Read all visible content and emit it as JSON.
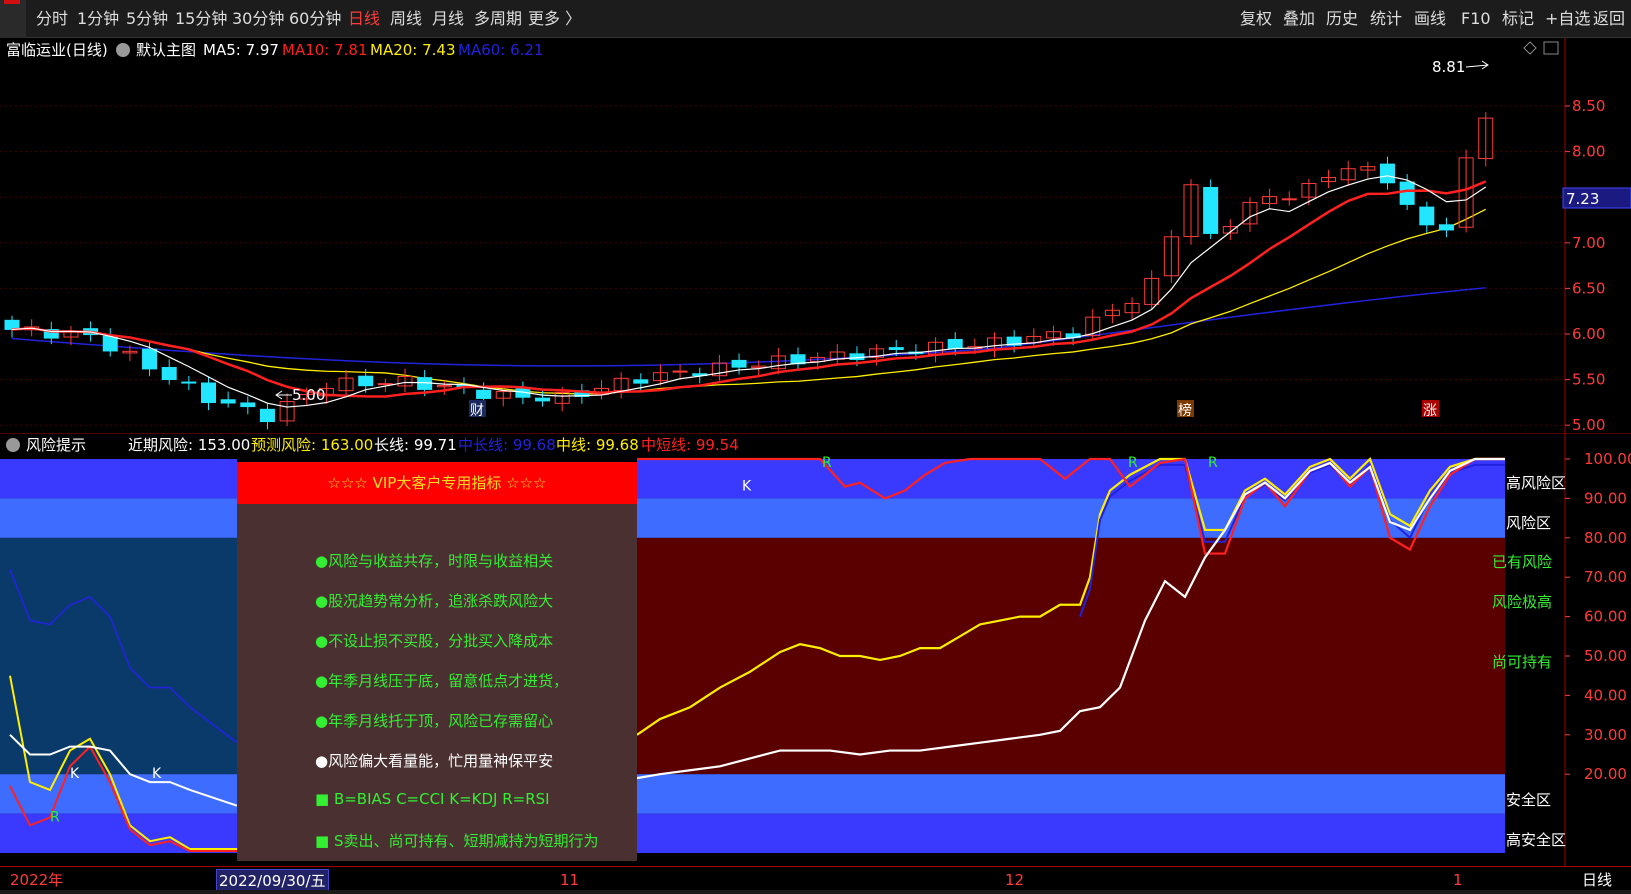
{
  "toolbar": {
    "left": [
      {
        "id": "minute",
        "label": "分时"
      },
      {
        "id": "1min",
        "label": "1分钟"
      },
      {
        "id": "5min",
        "label": "5分钟"
      },
      {
        "id": "15min",
        "label": "15分钟"
      },
      {
        "id": "30min",
        "label": "30分钟"
      },
      {
        "id": "60min",
        "label": "60分钟"
      },
      {
        "id": "day",
        "label": "日线",
        "active": true
      },
      {
        "id": "week",
        "label": "周线"
      },
      {
        "id": "month",
        "label": "月线"
      },
      {
        "id": "multi",
        "label": "多周期"
      },
      {
        "id": "more",
        "label": "更多 〉"
      }
    ],
    "right": [
      {
        "id": "restore",
        "label": "复权"
      },
      {
        "id": "overlay",
        "label": "叠加"
      },
      {
        "id": "history",
        "label": "历史"
      },
      {
        "id": "stats",
        "label": "统计"
      },
      {
        "id": "draw",
        "label": "画线"
      },
      {
        "id": "f10",
        "label": "F10"
      },
      {
        "id": "mark",
        "label": "标记"
      },
      {
        "id": "watch",
        "label": "+自选"
      },
      {
        "id": "back",
        "label": "返回"
      }
    ]
  },
  "main_header": {
    "stock": "富临运业(日线)",
    "template": "默认主图",
    "ma5": "MA5: 7.97",
    "ma10": "MA10: 7.81",
    "ma20": "MA20: 7.43",
    "ma60": "MA60: 6.21"
  },
  "colors": {
    "up": "#ff3b3b",
    "down": "#22e6ff",
    "ma5": "#ffffff",
    "ma10": "#ff2020",
    "ma20": "#ffee00",
    "ma60": "#2222dd",
    "axis": "#ff3a3a",
    "zone_blue_dark": "#3a3aff",
    "zone_blue_light": "#3e6cff",
    "zone_red": "#5a0000",
    "left_dark": "#0a3a6a"
  },
  "price_axis": {
    "ticks": [
      "8.50",
      "8.00",
      "7.50",
      "7.00",
      "6.50",
      "6.00",
      "5.50",
      "5.00"
    ],
    "current_price": "7.23"
  },
  "price_annotations": {
    "high": "8.81",
    "low": "5.00",
    "event_cai": "财",
    "event_bang": "榜",
    "event_zhang": "涨"
  },
  "sub_header": {
    "name": "风险提示",
    "recent_risk": "近期风险: 153.00",
    "pred_risk": "预测风险: 163.00",
    "long_line": "长线: 99.71",
    "mid_long_line": "中长线: 99.68",
    "mid_line": "中线: 99.68",
    "mid_short_line": "中短线: 99.54"
  },
  "sub_axis": {
    "ticks": [
      "100.00",
      "90.00",
      "80.00",
      "70.00",
      "60.00",
      "50.00",
      "40.00",
      "30.00",
      "20.00"
    ]
  },
  "zone_labels": {
    "high_risk": "高风险区",
    "risk": "风险区",
    "has_risk": "已有风险",
    "very_high": "风险极高",
    "holdable": "尚可持有",
    "safe": "安全区",
    "high_safe": "高安全区"
  },
  "markers": {
    "k": "K",
    "r": "R"
  },
  "vip": {
    "title": "☆☆☆ VIP大客户专用指标 ☆☆☆",
    "lines": [
      "●风险与收益共存，时限与收益相关",
      "●股况趋势常分析，追涨杀跌风险大",
      "●不设止损不买股，分批买入降成本",
      "●年季月线压于底，留意低点才进货，",
      "●年季月线托于顶，风险已存需留心",
      "●风险偏大看量能，忙用量神保平安",
      "■ B=BIAS    C=CCI    K=KDJ    R=RSI",
      "■ S卖出、尚可持有、短期减持为短期行为"
    ]
  },
  "date_axis": {
    "year": "2022年",
    "selected_date": "2022/09/30/五",
    "month_11": "11",
    "month_12": "12",
    "month_1": "1",
    "period": "日线"
  }
}
